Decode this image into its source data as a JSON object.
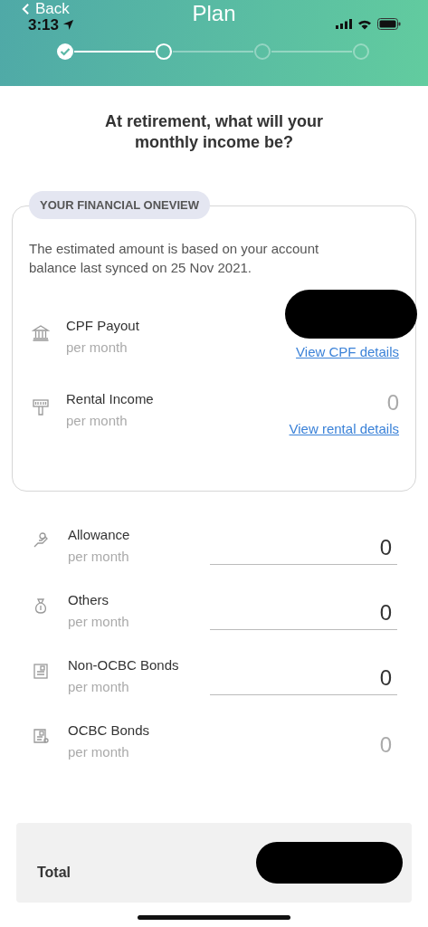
{
  "header": {
    "back": "Back",
    "title": "Plan",
    "time": "3:13",
    "steps": [
      {
        "completed": true,
        "selected": false
      },
      {
        "completed": false,
        "selected": true
      },
      {
        "completed": false,
        "selected": false
      },
      {
        "completed": false,
        "selected": false
      }
    ]
  },
  "question": "At retirement, what will your monthly income be?",
  "oneview": {
    "badge": "YOUR FINANCIAL ONEVIEW",
    "description": "The estimated amount is based on your account balance last synced on 25 Nov 2021.",
    "rows": [
      {
        "kind": "bank",
        "label": "CPF Payout",
        "sub": "per month",
        "redacted": true,
        "link": "View CPF details"
      },
      {
        "kind": "rent",
        "label": "Rental Income",
        "sub": "per month",
        "value": "0",
        "redacted": false,
        "link": "View rental details"
      }
    ]
  },
  "inputs": [
    {
      "kind": "hand",
      "label": "Allowance",
      "sub": "per month",
      "value": "0",
      "editable": true
    },
    {
      "kind": "bag",
      "label": "Others",
      "sub": "per month",
      "value": "0",
      "editable": true
    },
    {
      "kind": "doc",
      "label": "Non-OCBC Bonds",
      "sub": "per month",
      "value": "0",
      "editable": true
    },
    {
      "kind": "cert",
      "label": "OCBC Bonds",
      "sub": "per month",
      "value": "0",
      "editable": false
    }
  ],
  "total": {
    "label": "Total",
    "redacted": true
  }
}
